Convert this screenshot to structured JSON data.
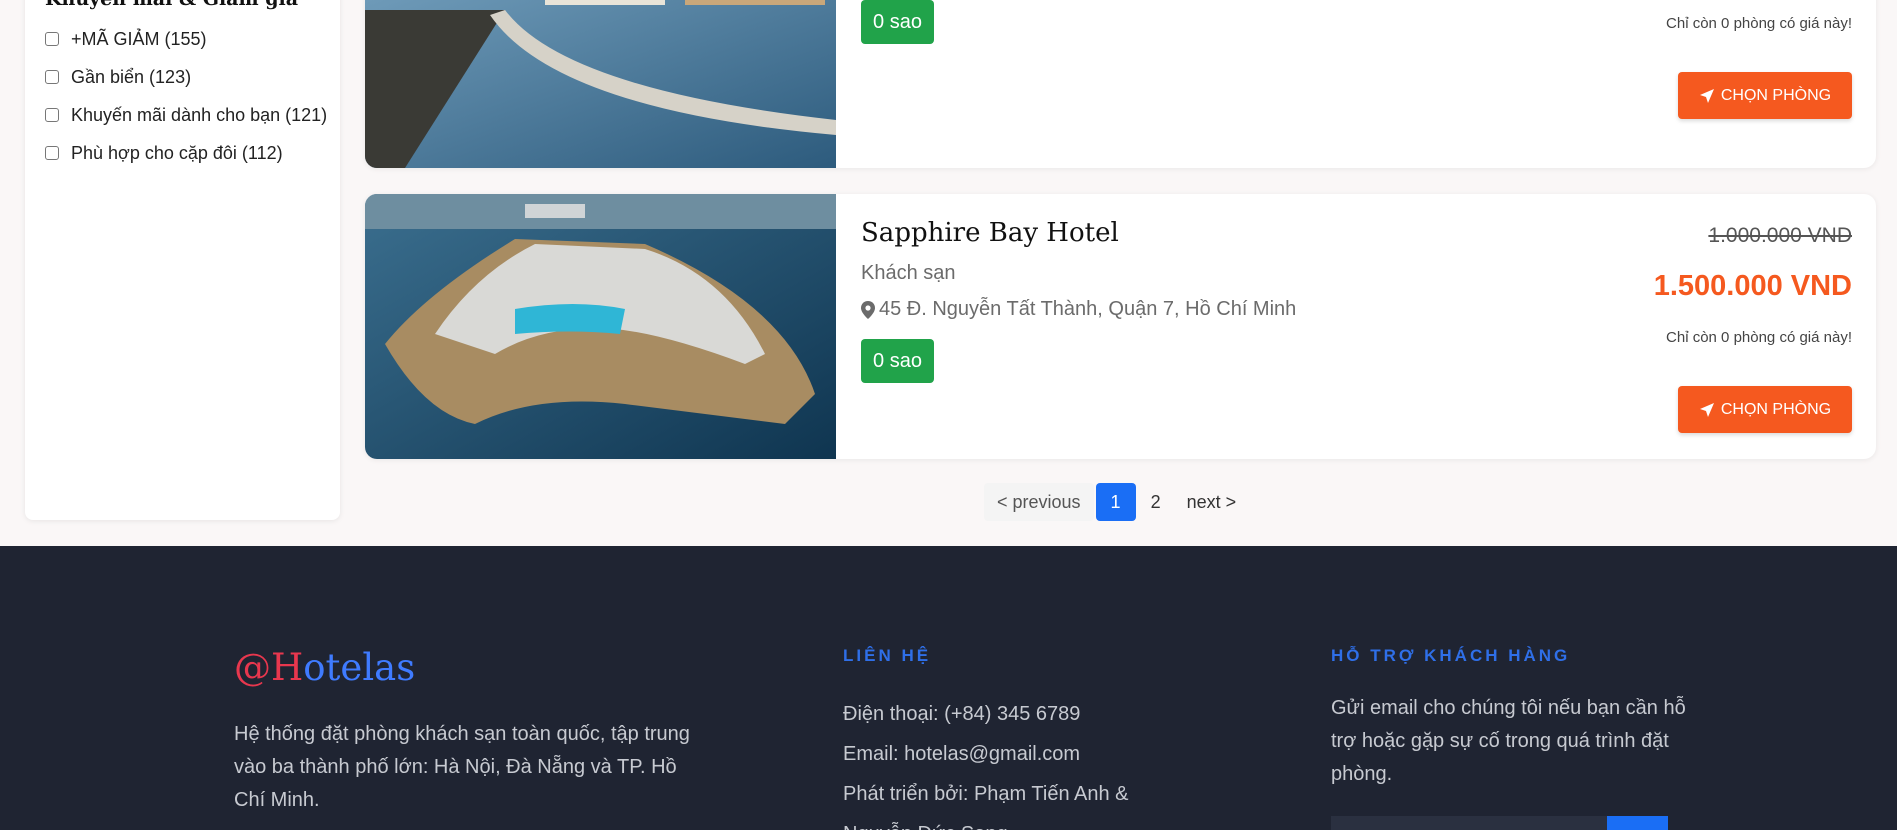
{
  "sidebar": {
    "title": "Khuyến mãi & Giảm giá",
    "filters": [
      {
        "label": "+MÃ GIẢM (155)"
      },
      {
        "label": "Gần biển (123)"
      },
      {
        "label": "Khuyến mãi dành cho bạn (121)"
      },
      {
        "label": "Phù hợp cho cặp đôi (112)"
      }
    ]
  },
  "hotels": [
    {
      "stars": "0 sao",
      "availability": "Chỉ còn 0 phòng có giá này!",
      "book_label": "CHỌN PHÒNG"
    },
    {
      "name": "Sapphire Bay Hotel",
      "type": "Khách sạn",
      "address": "45 Đ. Nguyễn Tất Thành, Quận 7, Hồ Chí Minh",
      "stars": "0 sao",
      "old_price": "1.000.000 VND",
      "price": "1.500.000 VND",
      "availability": "Chỉ còn 0 phòng có giá này!",
      "book_label": "CHỌN PHÒNG"
    }
  ],
  "pagination": {
    "previous": "< previous",
    "pages": [
      "1",
      "2"
    ],
    "current": "1",
    "next": "next >"
  },
  "footer": {
    "brand_prefix": "@H",
    "brand_rest": "otelas",
    "description": "Hệ thống đặt phòng khách sạn toàn quốc, tập trung vào ba thành phố lớn: Hà Nội, Đà Nẵng và TP. Hồ Chí Minh.",
    "contact_title": "LIÊN HỆ",
    "contact": {
      "phone": "Điện thoại: (+84) 345 6789",
      "email": "Email: hotelas@gmail.com",
      "developers": "Phát triển bởi: Phạm Tiến Anh & Nguyễn Đức Sang"
    },
    "support_title": "HỖ TRỢ KHÁCH HÀNG",
    "support_text": "Gửi email cho chúng tôi nếu bạn cần hỗ trợ hoặc gặp sự cố trong quá trình đặt phòng."
  },
  "colors": {
    "accent_orange": "#f5591f",
    "star_green": "#21a34a",
    "primary_blue": "#1a6ef5",
    "footer_bg": "#1f2432"
  }
}
